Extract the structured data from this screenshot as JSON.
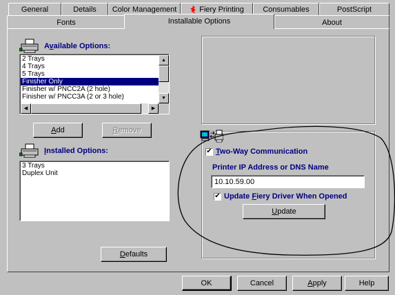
{
  "tabs_top": [
    {
      "label": "General"
    },
    {
      "label": "Details"
    },
    {
      "label": "Color Management"
    },
    {
      "label": "Fiery Printing"
    },
    {
      "label": "Consumables"
    },
    {
      "label": "PostScript"
    }
  ],
  "tabs_bottom": [
    {
      "label": "Fonts"
    },
    {
      "label": "Installable Options"
    },
    {
      "label": "About"
    }
  ],
  "available": {
    "label_pre": "A",
    "label_mnemonic": "v",
    "label_post": "ailable Options:",
    "items": [
      {
        "text": "2 Trays",
        "selected": false
      },
      {
        "text": "4 Trays",
        "selected": false
      },
      {
        "text": "5 Trays",
        "selected": false
      },
      {
        "text": "Finisher Only",
        "selected": true
      },
      {
        "text": "Finisher w/ PNCC2A (2 hole)",
        "selected": false
      },
      {
        "text": "Finisher w/ PNCC3A (2 or 3 hole)",
        "selected": false
      }
    ]
  },
  "buttons": {
    "add_mn": "A",
    "add_rest": "dd",
    "remove_mn": "R",
    "remove_rest": "emove",
    "defaults_mn": "D",
    "defaults_rest": "efaults",
    "update_mn": "U",
    "update_rest": "pdate",
    "ok": "OK",
    "cancel": "Cancel",
    "apply_mn": "A",
    "apply_rest": "pply",
    "help": "Help"
  },
  "installed": {
    "label_mnemonic": "I",
    "label_post": "nstalled Options:",
    "items": [
      "3 Trays",
      "Duplex Unit"
    ]
  },
  "twoway": {
    "checked_glyph": "✔",
    "label_mnemonic": "T",
    "label_post": "wo-Way Communication",
    "ip_label": "Printer IP Address or DNS Name",
    "ip_value": "10.10.59.00",
    "update_pre": "Update ",
    "update_mnemonic": "F",
    "update_post": "iery Driver When Opened"
  },
  "colors": {
    "accent": "#000080",
    "face": "#c0c0c0",
    "fiery_red": "#ff0000"
  },
  "icons": {
    "printer": "printer-icon",
    "fiery": "fiery-flame-icon",
    "two_way": "two-way-communication-icon"
  }
}
